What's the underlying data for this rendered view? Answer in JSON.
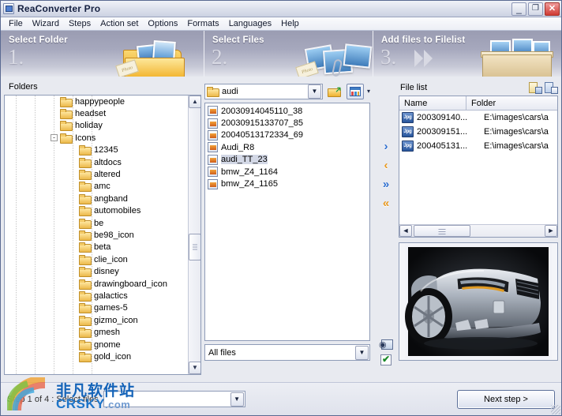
{
  "window": {
    "title": "ReaConverter Pro",
    "icon": "app-icon",
    "controls": {
      "minimize": "_",
      "maximize": "❐",
      "close": "✕"
    }
  },
  "menu": {
    "items": [
      "File",
      "Wizard",
      "Steps",
      "Action set",
      "Options",
      "Formats",
      "Languages",
      "Help"
    ]
  },
  "steps_header": [
    {
      "title": "Select Folder",
      "number": "1."
    },
    {
      "title": "Select Files",
      "number": "2."
    },
    {
      "title": "Add files to Filelist",
      "number": "3."
    }
  ],
  "folders_panel": {
    "label": "Folders",
    "tree": [
      {
        "name": "happypeople",
        "indent": 1,
        "expander": "",
        "selected": false
      },
      {
        "name": "headset",
        "indent": 1,
        "expander": "",
        "selected": false
      },
      {
        "name": "holiday",
        "indent": 1,
        "expander": "",
        "selected": false
      },
      {
        "name": "Icons",
        "indent": 1,
        "expander": "-",
        "selected": false
      },
      {
        "name": "12345",
        "indent": 2,
        "expander": "",
        "selected": false
      },
      {
        "name": "altdocs",
        "indent": 2,
        "expander": "",
        "selected": false
      },
      {
        "name": "altered",
        "indent": 2,
        "expander": "",
        "selected": false
      },
      {
        "name": "amc",
        "indent": 2,
        "expander": "",
        "selected": false
      },
      {
        "name": "angband",
        "indent": 2,
        "expander": "",
        "selected": false
      },
      {
        "name": "automobiles",
        "indent": 2,
        "expander": "",
        "selected": false
      },
      {
        "name": "be",
        "indent": 2,
        "expander": "",
        "selected": false
      },
      {
        "name": "be98_icon",
        "indent": 2,
        "expander": "",
        "selected": false
      },
      {
        "name": "beta",
        "indent": 2,
        "expander": "",
        "selected": false
      },
      {
        "name": "clie_icon",
        "indent": 2,
        "expander": "",
        "selected": false
      },
      {
        "name": "disney",
        "indent": 2,
        "expander": "",
        "selected": false
      },
      {
        "name": "drawingboard_icon",
        "indent": 2,
        "expander": "",
        "selected": false
      },
      {
        "name": "galactics",
        "indent": 2,
        "expander": "",
        "selected": false
      },
      {
        "name": "games-5",
        "indent": 2,
        "expander": "",
        "selected": false
      },
      {
        "name": "gizmo_icon",
        "indent": 2,
        "expander": "",
        "selected": false
      },
      {
        "name": "gmesh",
        "indent": 2,
        "expander": "",
        "selected": false
      },
      {
        "name": "gnome",
        "indent": 2,
        "expander": "",
        "selected": false
      },
      {
        "name": "gold_icon",
        "indent": 2,
        "expander": "",
        "selected": false
      }
    ]
  },
  "files_panel": {
    "folder_combo": {
      "value": "audi",
      "icon": "folder-icon",
      "dropdown": "▼"
    },
    "toolbar": {
      "open_folder": "open-folder-icon",
      "views": "views-icon",
      "views_caret": "▾"
    },
    "files": [
      {
        "name": "20030914045110_38",
        "selected": false
      },
      {
        "name": "20030915133707_85",
        "selected": false
      },
      {
        "name": "20040513172334_69",
        "selected": false
      },
      {
        "name": "Audi_R8",
        "selected": false
      },
      {
        "name": "audi_TT_23",
        "selected": true
      },
      {
        "name": "bmw_Z4_1164",
        "selected": false
      },
      {
        "name": "bmw_Z4_1165",
        "selected": false
      }
    ],
    "filter_combo": {
      "value": "All files",
      "dropdown": "▼"
    }
  },
  "transfer_buttons": [
    {
      "name": "add-selected",
      "glyph": "›",
      "color": "#2f6fd0"
    },
    {
      "name": "remove-selected",
      "glyph": "‹",
      "color": "#e8991f"
    },
    {
      "name": "add-all",
      "glyph": "»",
      "color": "#2f6fd0"
    },
    {
      "name": "remove-all",
      "glyph": "«",
      "color": "#e8991f"
    }
  ],
  "side_toggles": [
    {
      "name": "preview-toggle",
      "icon": "eye-icon"
    },
    {
      "name": "check-toggle",
      "icon": "checkbox-checked-icon"
    }
  ],
  "filelist_panel": {
    "label": "File list",
    "header_buttons": [
      {
        "name": "load-filelist-icon",
        "title": "load-filelist"
      },
      {
        "name": "save-filelist-icon",
        "title": "save-filelist"
      }
    ],
    "columns": [
      "Name",
      "Folder"
    ],
    "rows": [
      {
        "badge": "Jpg",
        "name": "200309140...",
        "folder": "E:\\images\\cars\\a"
      },
      {
        "badge": "Jpg",
        "name": "200309151...",
        "folder": "E:\\images\\cars\\a"
      },
      {
        "badge": "Jpg",
        "name": "200405131...",
        "folder": "E:\\images\\cars\\a"
      }
    ],
    "hscroll": {
      "left": "◄",
      "right": "►"
    }
  },
  "preview_panel": {
    "alt": "silver Audi TT front quarter photo on black background"
  },
  "bottom_bar": {
    "step_text": "Step 1 of 4 : Select files",
    "step_combo_value": "",
    "next_button": "Next step >"
  },
  "watermark": {
    "chinese": "非凡软件站",
    "site": "CRSKY",
    "tld": ".com"
  },
  "colors": {
    "accent_blue": "#2f6fd0",
    "accent_orange": "#e8991f",
    "header_gray": "#9a9cb2",
    "close_red": "#cf3a32"
  }
}
